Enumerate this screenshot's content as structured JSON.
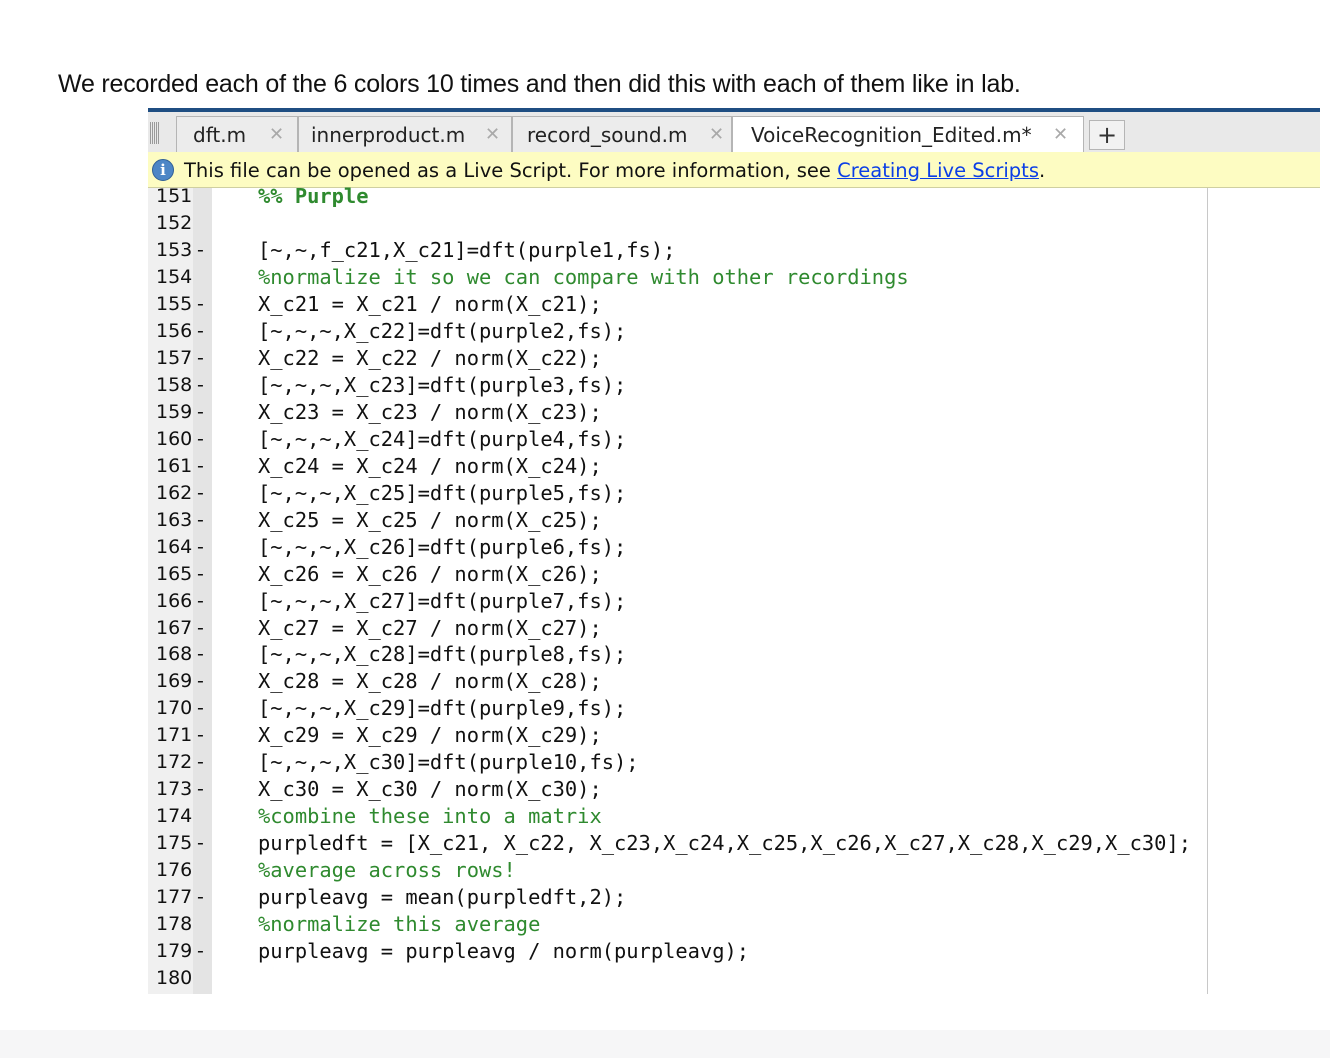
{
  "question": "We recorded each of the 6 colors 10 times and then did this with each of them like in lab.",
  "tabs": [
    {
      "label": "dft.m",
      "close": "✕"
    },
    {
      "label": "innerproduct.m",
      "close": "✕"
    },
    {
      "label": "record_sound.m",
      "close": "✕"
    },
    {
      "label": "VoiceRecognition_Edited.m*",
      "close": "✕",
      "active": true
    }
  ],
  "add_tab": "+",
  "infobar": {
    "icon": "i",
    "text": "This file can be opened as a Live Script. For more information, see ",
    "link": "Creating Live Scripts",
    "suffix": "."
  },
  "lines": [
    {
      "num": "151",
      "dash": "",
      "code": "%% Purple",
      "style": "section"
    },
    {
      "num": "152",
      "dash": "",
      "code": "",
      "style": "normal"
    },
    {
      "num": "153",
      "dash": "-",
      "code": "[~,~,f_c21,X_c21]=dft(purple1,fs);",
      "style": "normal"
    },
    {
      "num": "154",
      "dash": "",
      "code": "%normalize it so we can compare with other recordings",
      "style": "comment"
    },
    {
      "num": "155",
      "dash": "-",
      "code": "X_c21 = X_c21 / norm(X_c21);",
      "style": "normal"
    },
    {
      "num": "156",
      "dash": "-",
      "code": "[~,~,~,X_c22]=dft(purple2,fs);",
      "style": "normal"
    },
    {
      "num": "157",
      "dash": "-",
      "code": "X_c22 = X_c22 / norm(X_c22);",
      "style": "normal"
    },
    {
      "num": "158",
      "dash": "-",
      "code": "[~,~,~,X_c23]=dft(purple3,fs);",
      "style": "normal"
    },
    {
      "num": "159",
      "dash": "-",
      "code": "X_c23 = X_c23 / norm(X_c23);",
      "style": "normal"
    },
    {
      "num": "160",
      "dash": "-",
      "code": "[~,~,~,X_c24]=dft(purple4,fs);",
      "style": "normal"
    },
    {
      "num": "161",
      "dash": "-",
      "code": "X_c24 = X_c24 / norm(X_c24);",
      "style": "normal"
    },
    {
      "num": "162",
      "dash": "-",
      "code": "[~,~,~,X_c25]=dft(purple5,fs);",
      "style": "normal"
    },
    {
      "num": "163",
      "dash": "-",
      "code": "X_c25 = X_c25 / norm(X_c25);",
      "style": "normal"
    },
    {
      "num": "164",
      "dash": "-",
      "code": "[~,~,~,X_c26]=dft(purple6,fs);",
      "style": "normal"
    },
    {
      "num": "165",
      "dash": "-",
      "code": "X_c26 = X_c26 / norm(X_c26);",
      "style": "normal"
    },
    {
      "num": "166",
      "dash": "-",
      "code": "[~,~,~,X_c27]=dft(purple7,fs);",
      "style": "normal"
    },
    {
      "num": "167",
      "dash": "-",
      "code": "X_c27 = X_c27 / norm(X_c27);",
      "style": "normal"
    },
    {
      "num": "168",
      "dash": "-",
      "code": "[~,~,~,X_c28]=dft(purple8,fs);",
      "style": "normal"
    },
    {
      "num": "169",
      "dash": "-",
      "code": "X_c28 = X_c28 / norm(X_c28);",
      "style": "normal"
    },
    {
      "num": "170",
      "dash": "-",
      "code": "[~,~,~,X_c29]=dft(purple9,fs);",
      "style": "normal"
    },
    {
      "num": "171",
      "dash": "-",
      "code": "X_c29 = X_c29 / norm(X_c29);",
      "style": "normal"
    },
    {
      "num": "172",
      "dash": "-",
      "code": "[~,~,~,X_c30]=dft(purple10,fs);",
      "style": "normal"
    },
    {
      "num": "173",
      "dash": "-",
      "code": "X_c30 = X_c30 / norm(X_c30);",
      "style": "normal"
    },
    {
      "num": "174",
      "dash": "",
      "code": "%combine these into a matrix",
      "style": "comment"
    },
    {
      "num": "175",
      "dash": "-",
      "code": "purpledft = [X_c21, X_c22, X_c23,X_c24,X_c25,X_c26,X_c27,X_c28,X_c29,X_c30];",
      "style": "normal"
    },
    {
      "num": "176",
      "dash": "",
      "code": "%average across rows!",
      "style": "comment"
    },
    {
      "num": "177",
      "dash": "-",
      "code": "purpleavg = mean(purpledft,2);",
      "style": "normal"
    },
    {
      "num": "178",
      "dash": "",
      "code": "%normalize this average",
      "style": "comment"
    },
    {
      "num": "179",
      "dash": "-",
      "code": "purpleavg = purpleavg / norm(purpleavg);",
      "style": "normal"
    },
    {
      "num": "180",
      "dash": "",
      "code": "",
      "style": "normal"
    }
  ]
}
